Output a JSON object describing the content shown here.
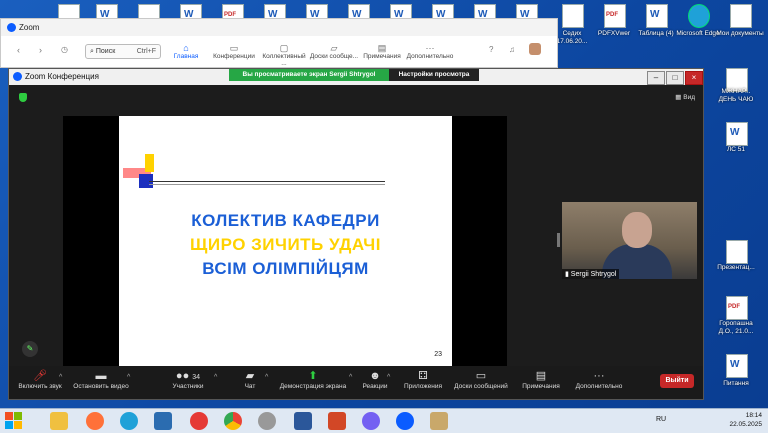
{
  "desktop": {
    "icons_right": [
      {
        "label": "Седих 17.06.20..."
      },
      {
        "label": "PDFXVwer"
      },
      {
        "label": "Таблица (4)"
      },
      {
        "label": "Microsoft Edge"
      },
      {
        "label": "Мои документы"
      },
      {
        "label": "МЖНАР... ДЕНЬ ЧАЮ"
      },
      {
        "label": "ЛС 51"
      },
      {
        "label": "Презентац..."
      },
      {
        "label": "Горопашна Д.О., 21.0..."
      },
      {
        "label": "Питання"
      }
    ]
  },
  "zoom_main": {
    "title": "Zoom",
    "search_label": "Поиск",
    "search_shortcut": "Ctrl+F",
    "tabs": [
      {
        "label": "Главная",
        "icon": "home-icon"
      },
      {
        "label": "Конференции",
        "icon": "video-icon"
      },
      {
        "label": "Коллективный ...",
        "icon": "chat-icon"
      },
      {
        "label": "Доски сообще...",
        "icon": "whiteboard-icon"
      },
      {
        "label": "Примечания",
        "icon": "notes-icon"
      },
      {
        "label": "Дополнительно",
        "icon": "more-icon"
      }
    ]
  },
  "meeting": {
    "title": "Zoom Конференция",
    "share_banner": "Вы просматриваете экран Sergii Shtrygol",
    "view_options": "Настройки просмотра",
    "view_label": "Вид",
    "slide": {
      "line1": "КОЛЕКТИВ КАФЕДРИ",
      "line2": "ЩИРО ЗИЧИТЬ УДАЧІ",
      "line3": "ВСІМ  ОЛІМПІЙЦЯМ",
      "page_number": "23"
    },
    "participant_name": "Sergii Shtrygol",
    "participants_count": "34",
    "toolbar": [
      {
        "label": "Включить звук",
        "icon": "mic-muted-icon"
      },
      {
        "label": "Остановить видео",
        "icon": "camera-icon"
      },
      {
        "label": "Участники",
        "icon": "participants-icon"
      },
      {
        "label": "Чат",
        "icon": "chat-icon"
      },
      {
        "label": "Демонстрация экрана",
        "icon": "share-screen-icon"
      },
      {
        "label": "Реакции",
        "icon": "reactions-icon"
      },
      {
        "label": "Приложения",
        "icon": "apps-icon"
      },
      {
        "label": "Доски сообщений",
        "icon": "whiteboard-icon"
      },
      {
        "label": "Примечания",
        "icon": "notes-icon"
      },
      {
        "label": "Дополнительно",
        "icon": "more-icon"
      }
    ],
    "leave_label": "Выйти"
  },
  "taskbar": {
    "lang": "RU",
    "time": "18:14",
    "date": "22.05.2025"
  },
  "colors": {
    "slide_blue": "#1b5fd6",
    "slide_yellow": "#ffd200",
    "share_green": "#26a745",
    "leave_red": "#c62828"
  }
}
